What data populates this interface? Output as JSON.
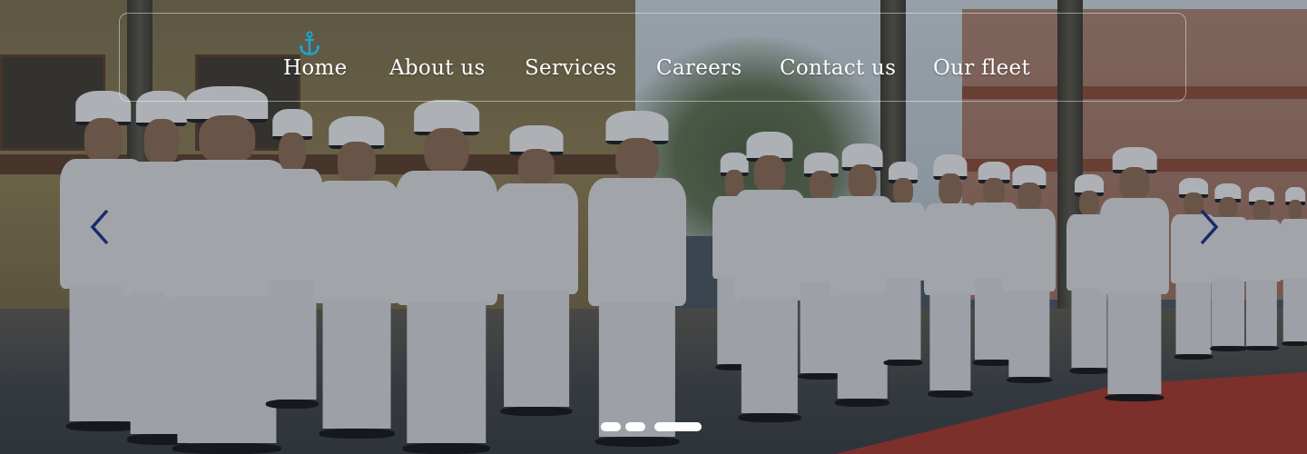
{
  "nav": {
    "logo_icon": "anchor-icon",
    "items": [
      {
        "label": "Home",
        "active": true
      },
      {
        "label": "About us",
        "active": false
      },
      {
        "label": "Services",
        "active": false
      },
      {
        "label": "Careers",
        "active": false
      },
      {
        "label": "Contact us",
        "active": false
      },
      {
        "label": "Our fleet",
        "active": false
      }
    ]
  },
  "slider": {
    "prev_icon": "chevron-left-icon",
    "next_icon": "chevron-right-icon",
    "slide_count": 3,
    "active_slide": 3
  },
  "colors": {
    "nav_text": "#ffffff",
    "accent_icon": "#1aa6d6",
    "arrow": "#1a2a6c",
    "dot": "#ffffff"
  }
}
